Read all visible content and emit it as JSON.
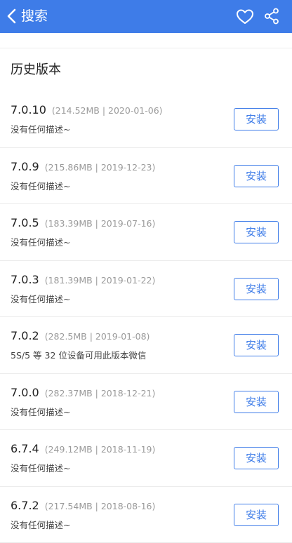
{
  "header": {
    "title": "搜索",
    "back_icon": "chevron-left-icon",
    "favorite_icon": "heart-icon",
    "share_icon": "share-icon",
    "color": "#3e7ce8"
  },
  "section": {
    "title": "历史版本"
  },
  "versions": [
    {
      "version": "7.0.10",
      "meta": "(214.52MB | 2020-01-06)",
      "desc": "没有任何描述~",
      "button": "安装"
    },
    {
      "version": "7.0.9",
      "meta": "(215.86MB | 2019-12-23)",
      "desc": "没有任何描述~",
      "button": "安装"
    },
    {
      "version": "7.0.5",
      "meta": "(183.39MB | 2019-07-16)",
      "desc": "没有任何描述~",
      "button": "安装"
    },
    {
      "version": "7.0.3",
      "meta": "(181.39MB | 2019-01-22)",
      "desc": "没有任何描述~",
      "button": "安装"
    },
    {
      "version": "7.0.2",
      "meta": "(282.5MB | 2019-01-08)",
      "desc": "5S/5 等 32 位设备可用此版本微信",
      "button": "安装"
    },
    {
      "version": "7.0.0",
      "meta": "(282.37MB | 2018-12-21)",
      "desc": "没有任何描述~",
      "button": "安装"
    },
    {
      "version": "6.7.4",
      "meta": "(249.12MB | 2018-11-19)",
      "desc": "没有任何描述~",
      "button": "安装"
    },
    {
      "version": "6.7.2",
      "meta": "(217.54MB | 2018-08-16)",
      "desc": "没有任何描述~",
      "button": "安装"
    }
  ]
}
